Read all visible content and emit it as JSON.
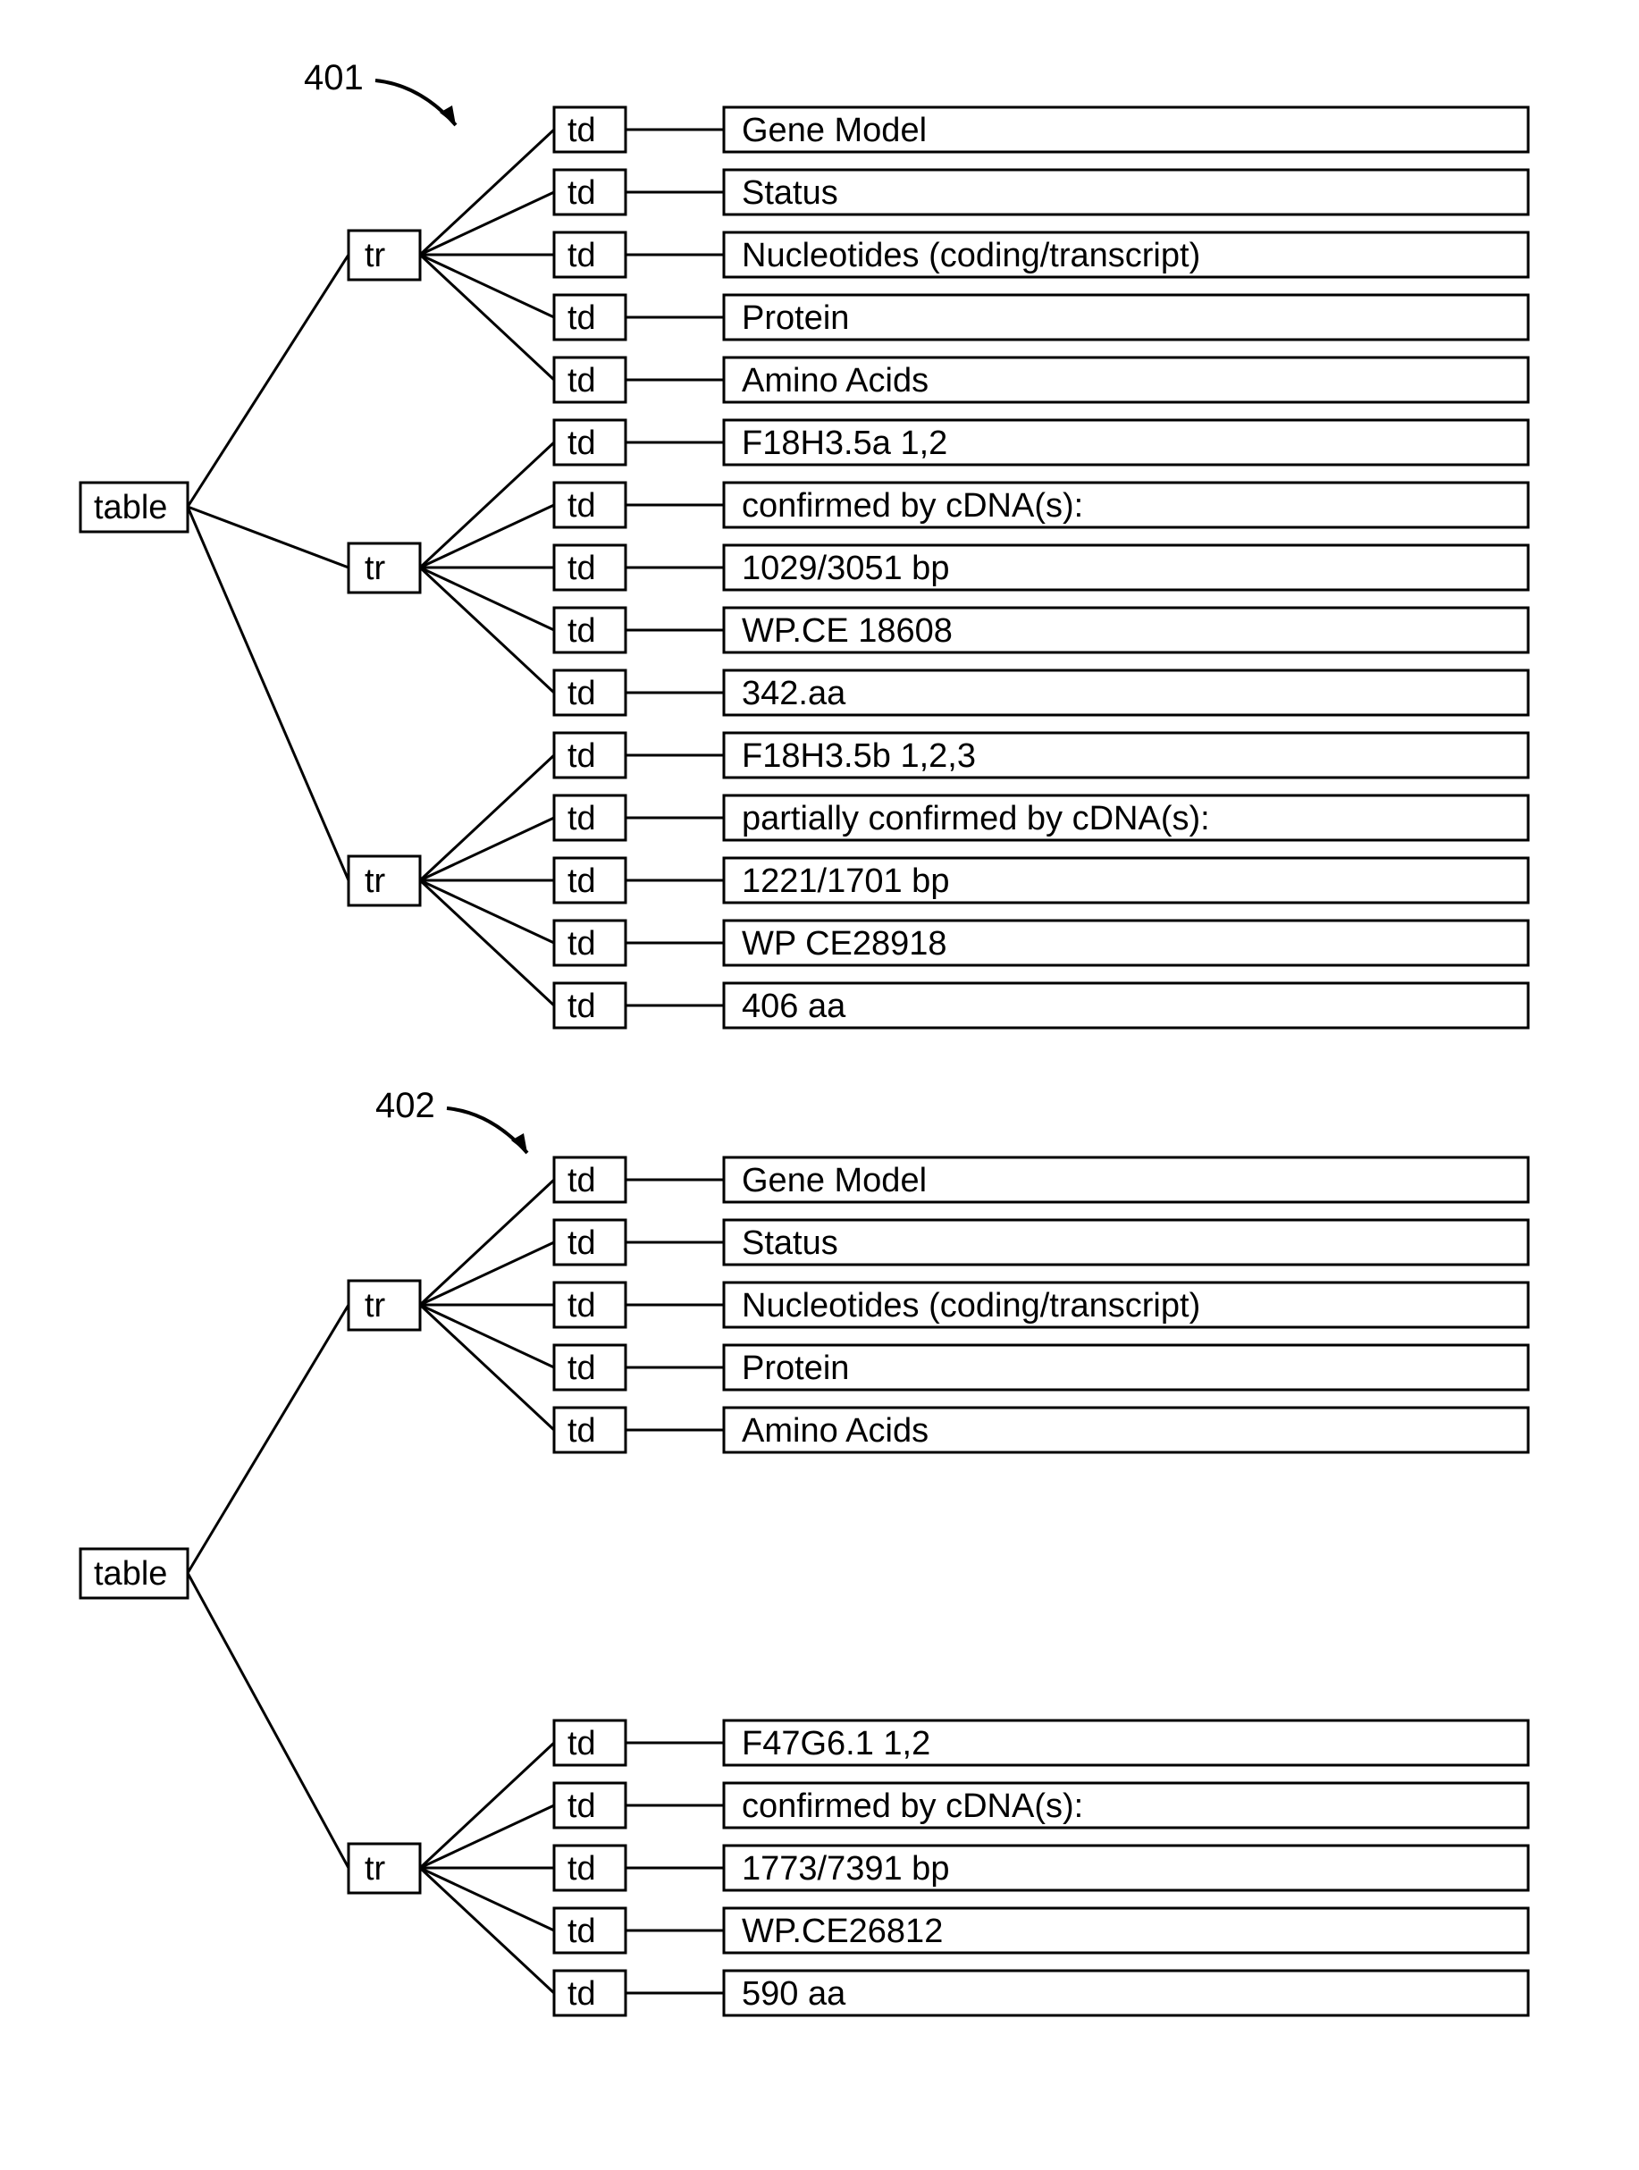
{
  "diagram1": {
    "ref": "401",
    "root": "table",
    "rows": [
      {
        "node": "tr",
        "cells": [
          {
            "node": "td",
            "value": "Gene Model"
          },
          {
            "node": "td",
            "value": "Status"
          },
          {
            "node": "td",
            "value": "Nucleotides (coding/transcript)"
          },
          {
            "node": "td",
            "value": "Protein"
          },
          {
            "node": "td",
            "value": "Amino Acids"
          }
        ]
      },
      {
        "node": "tr",
        "cells": [
          {
            "node": "td",
            "value": "F18H3.5a 1,2"
          },
          {
            "node": "td",
            "value": "confirmed by cDNA(s):"
          },
          {
            "node": "td",
            "value": "1029/3051 bp"
          },
          {
            "node": "td",
            "value": "WP.CE 18608"
          },
          {
            "node": "td",
            "value": "342.aa"
          }
        ]
      },
      {
        "node": "tr",
        "cells": [
          {
            "node": "td",
            "value": "F18H3.5b 1,2,3"
          },
          {
            "node": "td",
            "value": "partially confirmed by cDNA(s):"
          },
          {
            "node": "td",
            "value": "1221/1701 bp"
          },
          {
            "node": "td",
            "value": "WP CE28918"
          },
          {
            "node": "td",
            "value": "406 aa"
          }
        ]
      }
    ]
  },
  "diagram2": {
    "ref": "402",
    "root": "table",
    "rows": [
      {
        "node": "tr",
        "cells": [
          {
            "node": "td",
            "value": "Gene Model"
          },
          {
            "node": "td",
            "value": "Status"
          },
          {
            "node": "td",
            "value": "Nucleotides (coding/transcript)"
          },
          {
            "node": "td",
            "value": "Protein"
          },
          {
            "node": "td",
            "value": "Amino Acids"
          }
        ]
      },
      {
        "node": "tr",
        "cells": [
          {
            "node": "td",
            "value": "F47G6.1 1,2"
          },
          {
            "node": "td",
            "value": "confirmed by cDNA(s):"
          },
          {
            "node": "td",
            "value": "1773/7391 bp"
          },
          {
            "node": "td",
            "value": "WP.CE26812"
          },
          {
            "node": "td",
            "value": "590 aa"
          }
        ]
      }
    ]
  }
}
